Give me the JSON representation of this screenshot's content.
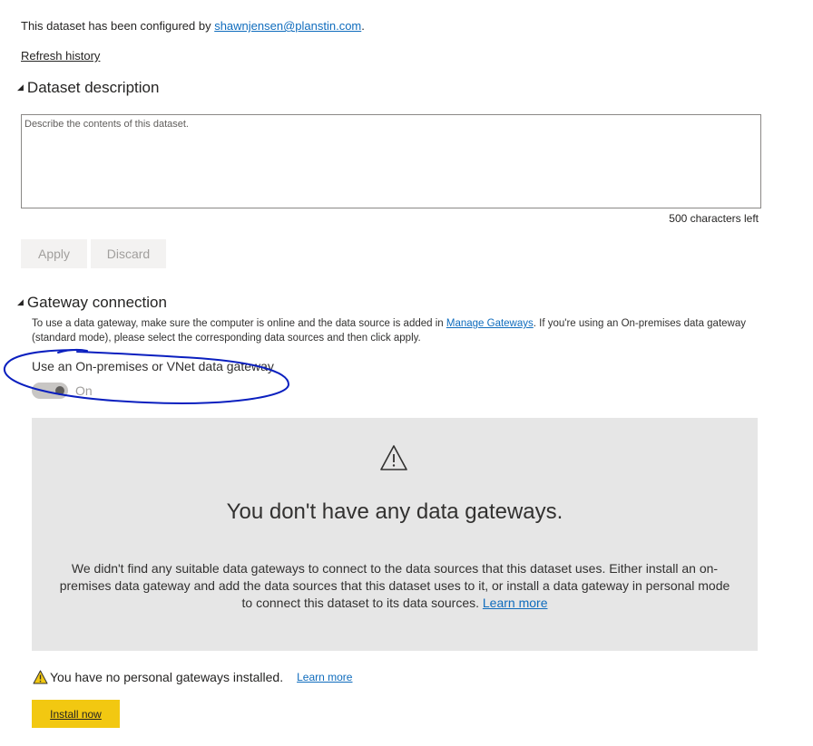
{
  "configured": {
    "prefix": "This dataset has been configured by ",
    "email": "shawnjensen@planstin.com",
    "suffix": "."
  },
  "refresh_history": "Refresh history",
  "description_section": {
    "title": "Dataset description",
    "placeholder": "Describe the contents of this dataset.",
    "chars_left": "500 characters left",
    "apply_label": "Apply",
    "discard_label": "Discard"
  },
  "gateway_section": {
    "title": "Gateway connection",
    "info_prefix": "To use a data gateway, make sure the computer is online and the data source is added in ",
    "manage_link": "Manage Gateways",
    "info_suffix": ". If you're using an On-premises data gateway (standard mode), please select the corresponding data sources and then click apply.",
    "toggle_label": "Use an On-premises or VNet data gateway",
    "toggle_state": "On"
  },
  "no_gateways_panel": {
    "icon": "warning-icon",
    "title": "You don't have any data gateways.",
    "body": "We didn't find any suitable data gateways to connect to the data sources that this dataset uses. Either install an on-premises data gateway and add the data sources that this dataset uses to it, or install a data gateway in personal mode to connect this dataset to its data sources.",
    "learn_more": "Learn more"
  },
  "personal_gateway": {
    "icon": "warning-icon",
    "message": "You have no personal gateways installed.",
    "learn_more": "Learn more",
    "install_label": "Install now"
  },
  "colors": {
    "link": "#0f6cbd",
    "annotation": "#0a1fbf",
    "install_button": "#f2c811",
    "panel_background": "#e6e6e6"
  }
}
